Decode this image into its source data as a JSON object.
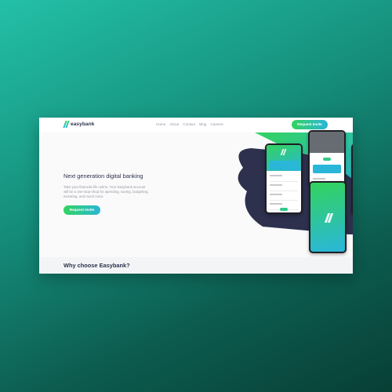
{
  "nav": {
    "brand": "easybank",
    "links": [
      "Home",
      "About",
      "Contact",
      "Blog",
      "Careers"
    ],
    "cta_label": "Request Invite"
  },
  "hero": {
    "title": "Next generation digital banking",
    "body": "Take your financial life online. Your Easybank account will be a one-stop-shop for spending, saving, budgeting, investing, and much more.",
    "cta_label": "Request Invite"
  },
  "section": {
    "heading": "Why choose Easybank?"
  },
  "colors": {
    "primary_dark": "#2d314d",
    "gradient_start": "#33d35e",
    "gradient_end": "#2ab6d9",
    "text_grey": "#9698a6",
    "page_background": "#1a9b86"
  },
  "icons": {
    "logo": "double-slash-logo-icon"
  }
}
